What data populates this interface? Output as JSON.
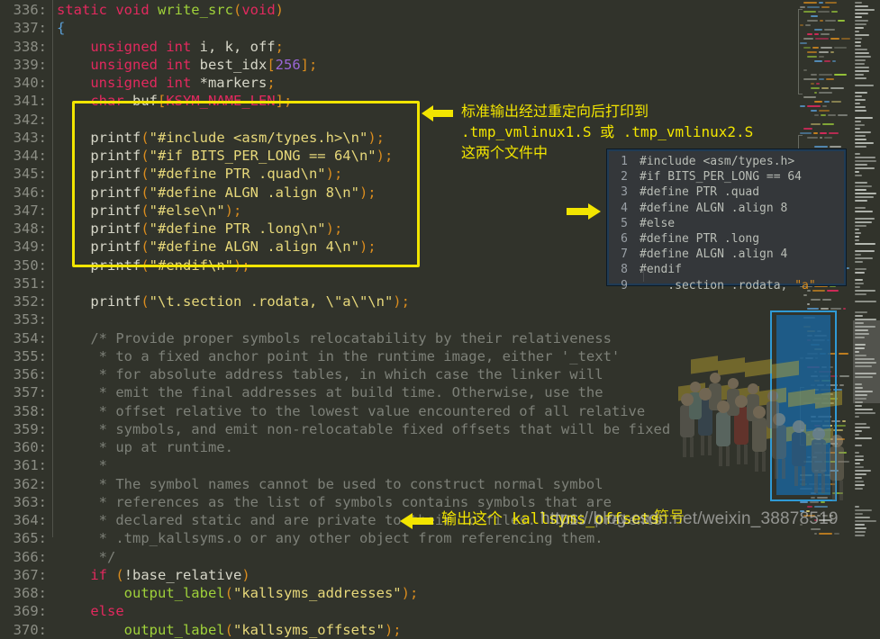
{
  "editor": {
    "background_color": "#31332b",
    "first_line_number": 336,
    "line_number_suffix": ":",
    "lines": [
      {
        "no": "336:",
        "tokens": [
          [
            "kw",
            "static void "
          ],
          [
            "fn",
            "write_src"
          ],
          [
            "pn",
            "("
          ],
          [
            "kw",
            "void"
          ],
          [
            "pn",
            ")"
          ]
        ]
      },
      {
        "no": "337:",
        "tokens": [
          [
            "br",
            "{"
          ]
        ]
      },
      {
        "no": "338:",
        "tokens": [
          [
            "pl",
            "    "
          ],
          [
            "kw",
            "unsigned int"
          ],
          [
            "pl",
            " i, k, off"
          ],
          [
            "pn",
            ";"
          ]
        ]
      },
      {
        "no": "339:",
        "tokens": [
          [
            "pl",
            "    "
          ],
          [
            "kw",
            "unsigned int"
          ],
          [
            "pl",
            " best_idx"
          ],
          [
            "pn",
            "["
          ],
          [
            "num",
            "256"
          ],
          [
            "pn",
            "];"
          ]
        ]
      },
      {
        "no": "340:",
        "tokens": [
          [
            "pl",
            "    "
          ],
          [
            "kw",
            "unsigned int"
          ],
          [
            "pl",
            " *markers"
          ],
          [
            "pn",
            ";"
          ]
        ]
      },
      {
        "no": "341:",
        "tokens": [
          [
            "pl",
            "    "
          ],
          [
            "kw",
            "char"
          ],
          [
            "pl",
            " buf"
          ],
          [
            "pn",
            "["
          ],
          [
            "mac",
            "KSYM_NAME_LEN"
          ],
          [
            "pn",
            "];"
          ]
        ]
      },
      {
        "no": "342:",
        "tokens": []
      },
      {
        "no": "343:",
        "tokens": [
          [
            "pl",
            "    printf"
          ],
          [
            "pn",
            "("
          ],
          [
            "str",
            "\"#include <asm/types.h>\\n\""
          ],
          [
            "pn",
            ");"
          ]
        ]
      },
      {
        "no": "344:",
        "tokens": [
          [
            "pl",
            "    printf"
          ],
          [
            "pn",
            "("
          ],
          [
            "str",
            "\"#if BITS_PER_LONG == 64\\n\""
          ],
          [
            "pn",
            ");"
          ]
        ]
      },
      {
        "no": "345:",
        "tokens": [
          [
            "pl",
            "    printf"
          ],
          [
            "pn",
            "("
          ],
          [
            "str",
            "\"#define PTR .quad\\n\""
          ],
          [
            "pn",
            ");"
          ]
        ]
      },
      {
        "no": "346:",
        "tokens": [
          [
            "pl",
            "    printf"
          ],
          [
            "pn",
            "("
          ],
          [
            "str",
            "\"#define ALGN .align 8\\n\""
          ],
          [
            "pn",
            ");"
          ]
        ]
      },
      {
        "no": "347:",
        "tokens": [
          [
            "pl",
            "    printf"
          ],
          [
            "pn",
            "("
          ],
          [
            "str",
            "\"#else\\n\""
          ],
          [
            "pn",
            ");"
          ]
        ]
      },
      {
        "no": "348:",
        "tokens": [
          [
            "pl",
            "    printf"
          ],
          [
            "pn",
            "("
          ],
          [
            "str",
            "\"#define PTR .long\\n\""
          ],
          [
            "pn",
            ");"
          ]
        ]
      },
      {
        "no": "349:",
        "tokens": [
          [
            "pl",
            "    printf"
          ],
          [
            "pn",
            "("
          ],
          [
            "str",
            "\"#define ALGN .align 4\\n\""
          ],
          [
            "pn",
            ");"
          ]
        ]
      },
      {
        "no": "350:",
        "tokens": [
          [
            "pl",
            "    printf"
          ],
          [
            "pn",
            "("
          ],
          [
            "str",
            "\"#endif\\n\""
          ],
          [
            "pn",
            ");"
          ]
        ]
      },
      {
        "no": "351:",
        "tokens": []
      },
      {
        "no": "352:",
        "tokens": [
          [
            "pl",
            "    printf"
          ],
          [
            "pn",
            "("
          ],
          [
            "str",
            "\"\\t.section .rodata, \\\"a\\\"\\n\""
          ],
          [
            "pn",
            ");"
          ]
        ]
      },
      {
        "no": "353:",
        "tokens": []
      },
      {
        "no": "354:",
        "tokens": [
          [
            "cmt",
            "    /* Provide proper symbols relocatability by their relativeness"
          ]
        ]
      },
      {
        "no": "355:",
        "tokens": [
          [
            "cmt",
            "     * to a fixed anchor point in the runtime image, either '_text'"
          ]
        ]
      },
      {
        "no": "356:",
        "tokens": [
          [
            "cmt",
            "     * for absolute address tables, in which case the linker will"
          ]
        ]
      },
      {
        "no": "357:",
        "tokens": [
          [
            "cmt",
            "     * emit the final addresses at build time. Otherwise, use the"
          ]
        ]
      },
      {
        "no": "358:",
        "tokens": [
          [
            "cmt",
            "     * offset relative to the lowest value encountered of all relative"
          ]
        ]
      },
      {
        "no": "359:",
        "tokens": [
          [
            "cmt",
            "     * symbols, and emit non-relocatable fixed offsets that will be fixed"
          ]
        ]
      },
      {
        "no": "360:",
        "tokens": [
          [
            "cmt",
            "     * up at runtime."
          ]
        ]
      },
      {
        "no": "361:",
        "tokens": [
          [
            "cmt",
            "     *"
          ]
        ]
      },
      {
        "no": "362:",
        "tokens": [
          [
            "cmt",
            "     * The symbol names cannot be used to construct normal symbol"
          ]
        ]
      },
      {
        "no": "363:",
        "tokens": [
          [
            "cmt",
            "     * references as the list of symbols contains symbols that are"
          ]
        ]
      },
      {
        "no": "364:",
        "tokens": [
          [
            "cmt",
            "     * declared static and are private to their .o files.  This prevents"
          ]
        ]
      },
      {
        "no": "365:",
        "tokens": [
          [
            "cmt",
            "     * .tmp_kallsyms.o or any other object from referencing them."
          ]
        ]
      },
      {
        "no": "366:",
        "tokens": [
          [
            "cmt",
            "     */"
          ]
        ]
      },
      {
        "no": "367:",
        "tokens": [
          [
            "pl",
            "    "
          ],
          [
            "kw",
            "if"
          ],
          [
            "pl",
            " "
          ],
          [
            "pn",
            "("
          ],
          [
            "pl",
            "!base_relative"
          ],
          [
            "pn",
            ")"
          ]
        ]
      },
      {
        "no": "368:",
        "tokens": [
          [
            "pl",
            "        "
          ],
          [
            "fn",
            "output_label"
          ],
          [
            "pn",
            "("
          ],
          [
            "str",
            "\"kallsyms_addresses\""
          ],
          [
            "pn",
            ");"
          ]
        ]
      },
      {
        "no": "369:",
        "tokens": [
          [
            "pl",
            "    "
          ],
          [
            "kw",
            "else"
          ]
        ]
      },
      {
        "no": "370:",
        "tokens": [
          [
            "pl",
            "        "
          ],
          [
            "fn",
            "output_label"
          ],
          [
            "pn",
            "("
          ],
          [
            "str",
            "\"kallsyms_offsets\""
          ],
          [
            "pn",
            ");"
          ]
        ]
      }
    ]
  },
  "highlight_box": {
    "color": "#f2e500",
    "covers_lines": "343-352"
  },
  "annotations": [
    {
      "id": "stdout-note",
      "arrow": "left-arrow-icon",
      "color": "#f2e500",
      "lines": [
        "标准输出经过重定向后打印到",
        ".tmp_vmlinux1.S 或 .tmp_vmlinux2.S",
        "这两个文件中"
      ]
    },
    {
      "id": "output-note",
      "arrow": "left-arrow-icon",
      "color": "#f2e500",
      "lines": [
        "输出这个 kallsyms_offsets"
      ]
    },
    {
      "id": "result-pointer",
      "arrow": "right-arrow-icon",
      "color": "#f2e500",
      "lines": []
    }
  ],
  "inner_panel": {
    "title": "generated-assembly-preview",
    "background_color": "#34373a",
    "border_color": "#1f3b55",
    "lines": [
      {
        "no": "1",
        "text": "#include <asm/types.h>"
      },
      {
        "no": "2",
        "text": "#if BITS_PER_LONG == 64"
      },
      {
        "no": "3",
        "text": "#define PTR .quad"
      },
      {
        "no": "4",
        "text": "#define ALGN .align 8"
      },
      {
        "no": "5",
        "text": "#else"
      },
      {
        "no": "6",
        "text": "#define PTR .long"
      },
      {
        "no": "7",
        "text": "#define ALGN .align 4"
      },
      {
        "no": "8",
        "text": "#endif"
      },
      {
        "no": "9",
        "text": "    .section .rodata, ",
        "quoted": "\"a\""
      }
    ]
  },
  "watermark": {
    "url": "https://blog.csdn.net/weixin_38878519",
    "chinese_overlay": "符号",
    "crowd_image": "crowd-holding-signs-watermark"
  }
}
